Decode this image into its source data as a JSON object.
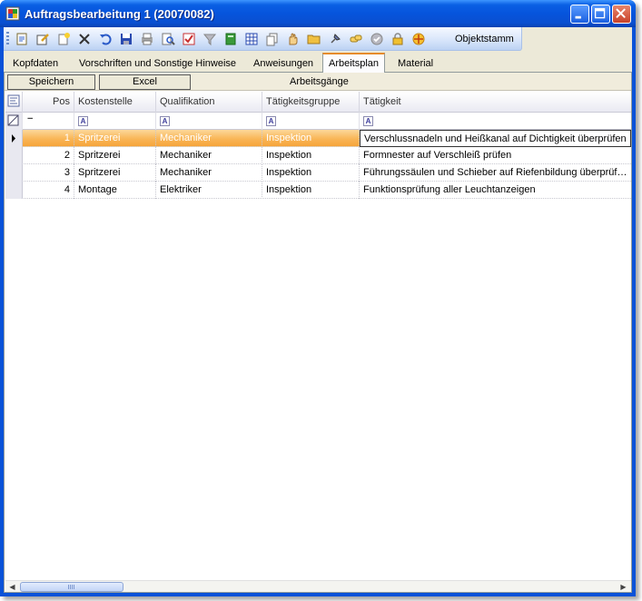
{
  "window": {
    "title": "Auftragsbearbeitung 1 (20070082)"
  },
  "toolbar": {
    "icons": [
      "properties-icon",
      "edit-icon",
      "new-icon",
      "delete-icon",
      "undo-icon",
      "save-icon",
      "print-icon",
      "preview-icon",
      "checklist-icon",
      "filter-icon",
      "book-icon",
      "table-icon",
      "copy-icon",
      "hand-icon",
      "open-folder-icon",
      "pin-icon",
      "link-icon",
      "approve-icon",
      "lock-icon",
      "move-icon"
    ],
    "objektstamm_label": "Objektstamm"
  },
  "tabs": [
    {
      "label": "Kopfdaten"
    },
    {
      "label": "Vorschriften und Sonstige Hinweise"
    },
    {
      "label": "Anweisungen"
    },
    {
      "label": "Arbeitsplan",
      "active": true
    },
    {
      "label": "Material"
    }
  ],
  "panel": {
    "save_label": "Speichern",
    "excel_label": "Excel",
    "band_title": "Arbeitsgänge"
  },
  "grid": {
    "columns": [
      "Pos",
      "Kostenstelle",
      "Qualifikation",
      "Tätigkeitsgruppe",
      "Tätigkeit"
    ],
    "filter_minus": "−",
    "rows": [
      {
        "pos": "1",
        "kostenstelle": "Spritzerei",
        "qualifikation": "Mechaniker",
        "gruppe": "Inspektion",
        "taetigkeit": "Verschlussnadeln und Heißkanal auf Dichtigkeit überprüfen"
      },
      {
        "pos": "2",
        "kostenstelle": "Spritzerei",
        "qualifikation": "Mechaniker",
        "gruppe": "Inspektion",
        "taetigkeit": "Formnester auf Verschleiß prüfen"
      },
      {
        "pos": "3",
        "kostenstelle": "Spritzerei",
        "qualifikation": "Mechaniker",
        "gruppe": "Inspektion",
        "taetigkeit": "Führungssäulen und Schieber auf Riefenbildung überprüfen"
      },
      {
        "pos": "4",
        "kostenstelle": "Montage",
        "qualifikation": "Elektriker",
        "gruppe": "Inspektion",
        "taetigkeit": "Funktionsprüfung aller Leuchtanzeigen"
      }
    ],
    "selected_row": 1
  },
  "colors": {
    "title_blue": "#0654dc",
    "selected_orange": "#f9b657",
    "tab_highlight": "#e68b2c"
  }
}
